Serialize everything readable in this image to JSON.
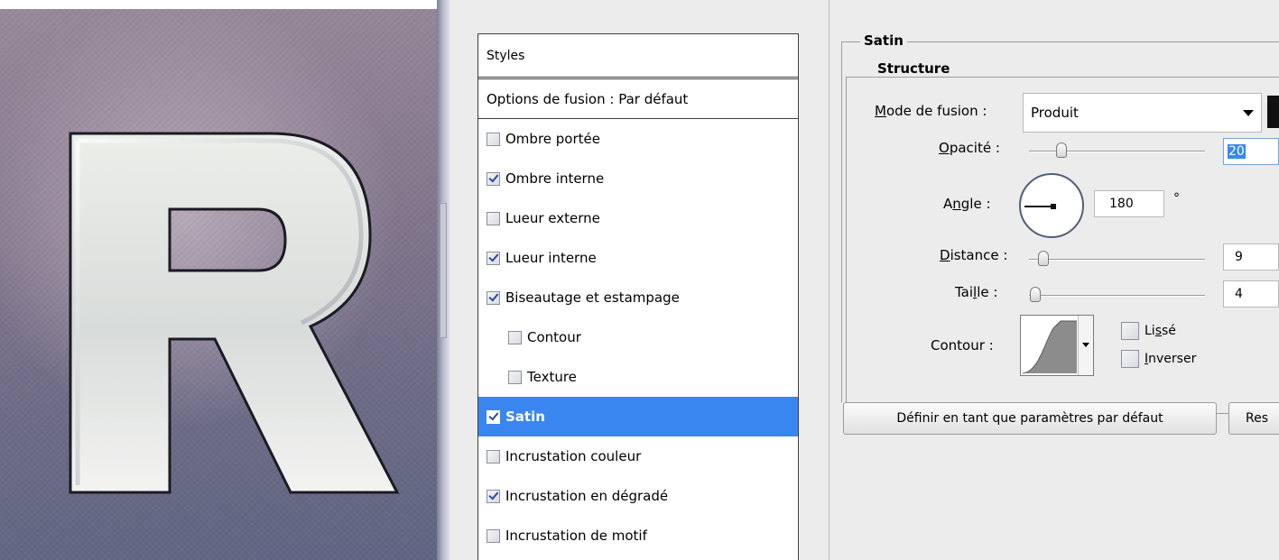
{
  "styles_panel": {
    "header": "Styles",
    "blending_options": "Options de fusion : Par défaut",
    "items": [
      {
        "label": "Ombre portée",
        "checked": false,
        "selected": false,
        "sub": false
      },
      {
        "label": "Ombre interne",
        "checked": true,
        "selected": false,
        "sub": false
      },
      {
        "label": "Lueur externe",
        "checked": false,
        "selected": false,
        "sub": false
      },
      {
        "label": "Lueur interne",
        "checked": true,
        "selected": false,
        "sub": false
      },
      {
        "label": "Biseautage et estampage",
        "checked": true,
        "selected": false,
        "sub": false
      },
      {
        "label": "Contour",
        "checked": false,
        "selected": false,
        "sub": true
      },
      {
        "label": "Texture",
        "checked": false,
        "selected": false,
        "sub": true
      },
      {
        "label": "Satin",
        "checked": true,
        "selected": true,
        "sub": false
      },
      {
        "label": "Incrustation couleur",
        "checked": false,
        "selected": false,
        "sub": false
      },
      {
        "label": "Incrustation en dégradé",
        "checked": true,
        "selected": false,
        "sub": false
      },
      {
        "label": "Incrustation de motif",
        "checked": false,
        "selected": false,
        "sub": false
      }
    ]
  },
  "satin": {
    "title": "Satin",
    "structure_title": "Structure",
    "blend_mode": {
      "label_u": "M",
      "label_rest": "ode de fusion :",
      "value": "Produit"
    },
    "opacity": {
      "label_u": "O",
      "label_rest": "pacité :",
      "value": "20"
    },
    "angle": {
      "label_pre": "A",
      "label_u": "n",
      "label_rest": "gle :",
      "value": "180",
      "unit": "°"
    },
    "distance": {
      "label_u": "D",
      "label_rest": "istance :",
      "value": "9"
    },
    "size": {
      "label_pre": "Tai",
      "label_u": "l",
      "label_rest": "le :",
      "value": "4"
    },
    "contour": {
      "label": "Contour :"
    },
    "antialiased": {
      "label_pre": "Li",
      "label_u": "s",
      "label_rest": "sé",
      "checked": false
    },
    "invert": {
      "label_u": "I",
      "label_rest": "nverser",
      "checked": false
    },
    "buttons": {
      "make_default": "Définir en tant que paramètres par défaut",
      "reset": "Res"
    }
  },
  "artwork": {
    "letter": "R"
  },
  "colors": {
    "selection": "#3a86f0",
    "dialog_bg": "#ececec"
  }
}
